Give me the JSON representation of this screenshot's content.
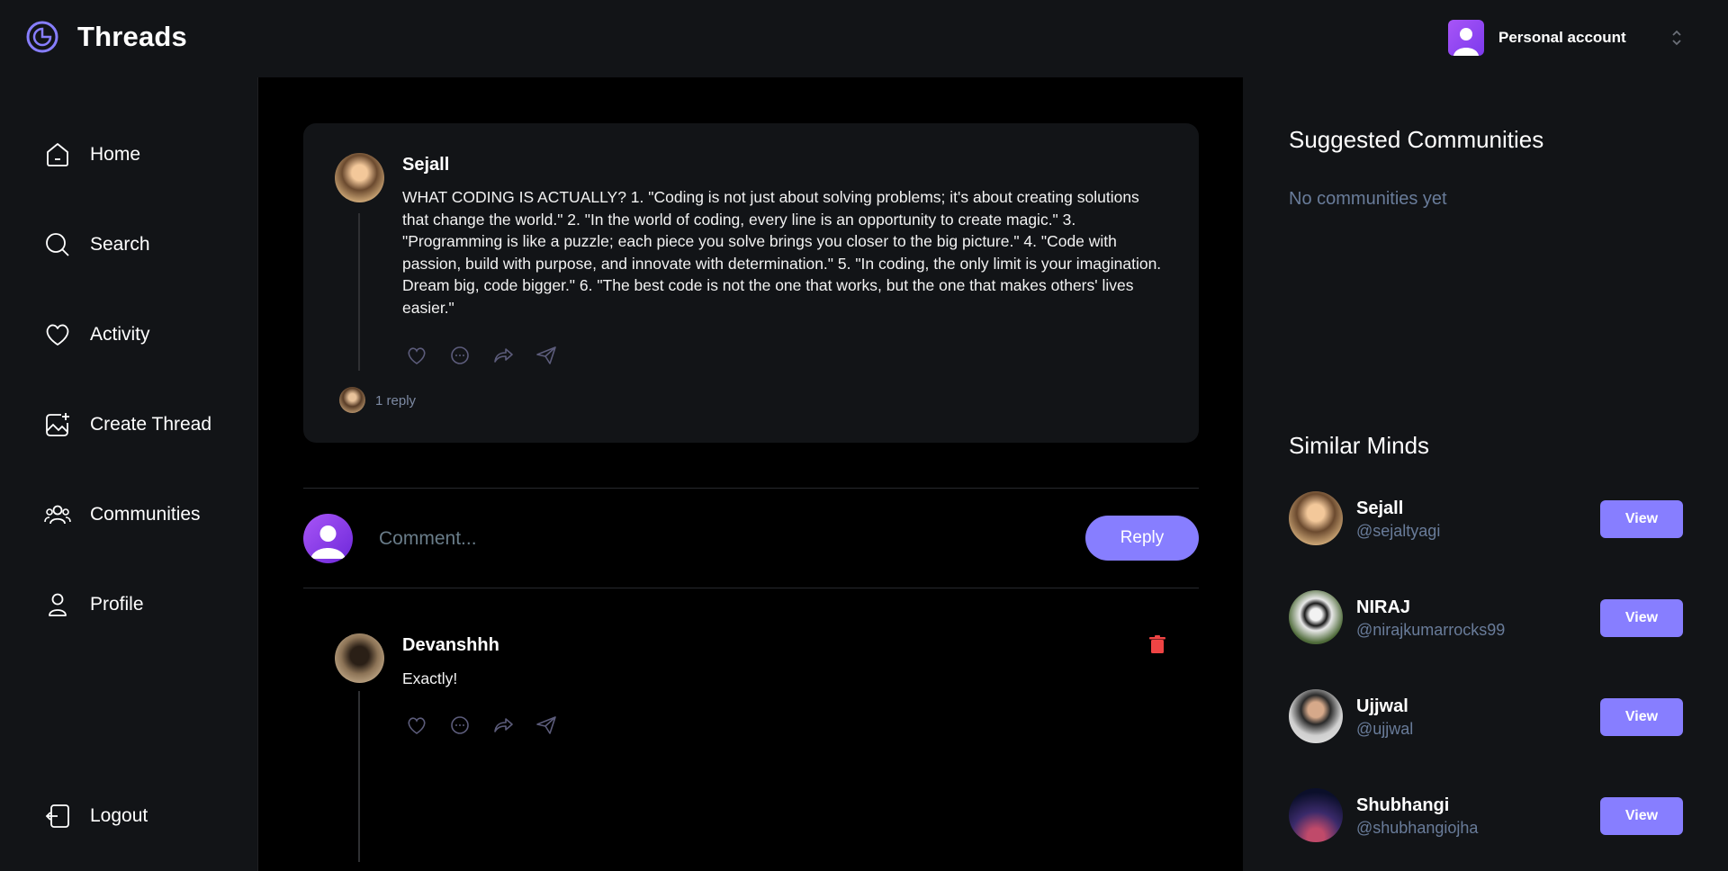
{
  "app": {
    "name": "Threads"
  },
  "account": {
    "label": "Personal account"
  },
  "nav": {
    "items": [
      {
        "label": "Home",
        "icon": "home-icon"
      },
      {
        "label": "Search",
        "icon": "search-icon"
      },
      {
        "label": "Activity",
        "icon": "heart-icon"
      },
      {
        "label": "Create Thread",
        "icon": "image-plus-icon"
      },
      {
        "label": "Communities",
        "icon": "users-icon"
      },
      {
        "label": "Profile",
        "icon": "user-icon"
      }
    ],
    "logout": "Logout"
  },
  "thread": {
    "author": "Sejall",
    "text": "WHAT CODING IS ACTUALLY? 1. \"Coding is not just about solving problems; it's about creating solutions that change the world.\" 2. \"In the world of coding, every line is an opportunity to create magic.\" 3. \"Programming is like a puzzle; each piece you solve brings you closer to the big picture.\" 4. \"Code with passion, build with purpose, and innovate with determination.\" 5. \"In coding, the only limit is your imagination. Dream big, code bigger.\" 6. \"The best code is not the one that works, but the one that makes others' lives easier.\"",
    "reply_count": "1 reply"
  },
  "comment_form": {
    "placeholder": "Comment...",
    "button": "Reply"
  },
  "reply": {
    "author": "Devanshhh",
    "text": "Exactly!"
  },
  "suggested": {
    "title": "Suggested Communities",
    "empty": "No communities yet"
  },
  "similar": {
    "title": "Similar Minds",
    "button": "View",
    "users": [
      {
        "name": "Sejall",
        "handle": "@sejaltyagi"
      },
      {
        "name": "NIRAJ",
        "handle": "@nirajkumarrocks99"
      },
      {
        "name": "Ujjwal",
        "handle": "@ujjwal"
      },
      {
        "name": "Shubhangi",
        "handle": "@shubhangiojha"
      }
    ]
  },
  "colors": {
    "accent": "#877eff",
    "bg_dark": "#121417",
    "muted": "#697c9a",
    "danger": "#ef4444"
  }
}
